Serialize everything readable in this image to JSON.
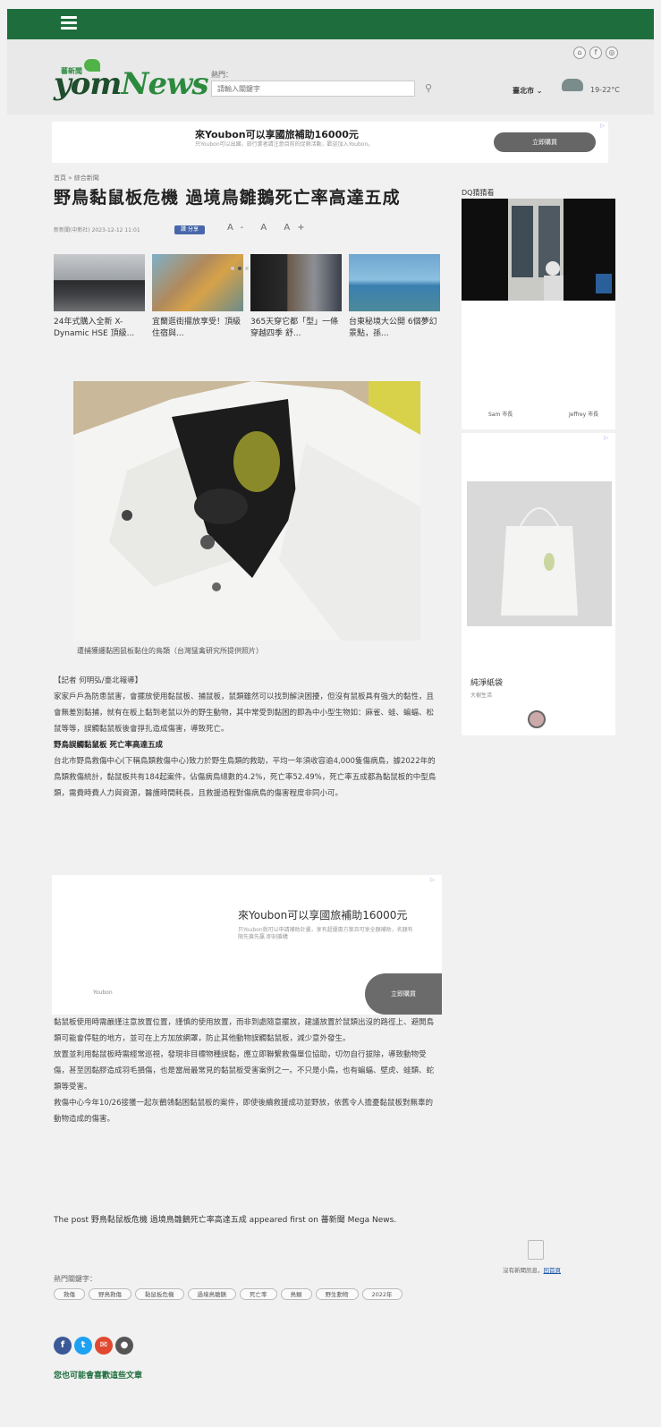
{
  "header": {
    "logo_prefix": "yom",
    "logo_suffix": "News",
    "logo_tag": "蕃新聞",
    "search_label": "熱門：",
    "search_placeholder": "請輸入關鍵字",
    "city": "臺北市",
    "temperature": "19-22°C"
  },
  "top_ad": {
    "title": "來Youbon可以享國旅補助16000元",
    "desc": "只Youbon可以出國，旅行業者請注意目前的促銷活動，歡迎加入Youbon。",
    "button": "立即購買"
  },
  "article": {
    "breadcrumb": "首頁 » 綜合新聞",
    "title": "野鳥黏鼠板危機 過境鳥雛鵝死亡率高達五成",
    "meta": "新新聞(中新社) 2023-12-12 11:01",
    "like": "讚 分享",
    "font_sizes": "A- A A+",
    "carousel": [
      {
        "caption": "24年式購入全新 X-Dynamic HSE 頂級..."
      },
      {
        "caption": "宜蘭逛街擺放享受！頂級住宿與..."
      },
      {
        "caption": "365天穿它都「型」一條穿越四季 舒..."
      },
      {
        "caption": "台東秘境大公開 6個夢幻景點，孫..."
      }
    ],
    "photo_caption": "遭捕獲纏黏困鼠板黏住的鳥類（台灣猛禽研究所提供照片）",
    "paragraphs": [
      "【記者 何明弘/臺北報導】",
      "家家戶戶為防患鼠害，會擺放使用黏鼠板、捕鼠板，鼠類雖然可以找到解決困擾，但沒有鼠板具有強大的黏性，且會無差別黏捕，就有在板上黏到老鼠以外的野生動物，其中常受到黏困的即為中小型生物如：麻雀、蛙、蝙蝠、松鼠等等，誤觸黏鼠板後會掙扎造成傷害，導致死亡。"
    ],
    "subheading": "野鳥誤觸黏鼠板 死亡率高達五成",
    "paragraph_after_sub": "台北市野鳥救傷中心(下稱鳥類救傷中心)致力於野生鳥類的救助，平均一年須收容逾4,000隻傷病鳥，據2022年的鳥類救傷統計，黏鼠板共有184起案件，佔傷病鳥總數的4.2%，死亡率52.49%，死亡率五成都為黏鼠板的中型鳥類，需費時費人力與資源，醫護時間耗長，且救援過程對傷病鳥的傷害程度非同小可。",
    "mid_ad": {
      "title": "來Youbon可以享國旅補助16000元",
      "desc": "只Youbon就可以申請補助計畫，享有超優惠方案且可享全額補助，名額有限先搶先贏 即刻搶購",
      "brand": "Youbon",
      "button": "立即購買"
    },
    "paragraphs_after_ad": [
      "黏鼠板使用時需嚴謹注意放置位置，謹慎的使用放置，而非到處隨意擺放，建議放置於鼠類出沒的路徑上、避開鳥類可能會停駐的地方，並可在上方加放網罩，防止其他動物誤觸黏鼠板，減少意外發生。",
      "放置並利用黏鼠板時需經常巡視，發現非目標物種誤黏，應立即聯繫救傷單位協助，切勿自行拔除，導致動物受傷，甚至因黏膠造成羽毛損傷，也是當局最常見的黏鼠板受害案例之一。不只是小鳥，也有蝙蝠、壁虎、蛙類、蛇類等受害。",
      "救傷中心今年10/26接獲一起灰鶺鴒黏困黏鼠板的案件，即使後續救援成功並野放，依舊令人擔憂黏鼠板對無辜的動物造成的傷害。"
    ],
    "post_line": "The post 野鳥黏鼠板危機 過境鳥雛鵝死亡率高達五成 appeared first on 蕃新聞 Mega News.",
    "keywords_label": "熱門關鍵字：",
    "keywords": [
      "救傷",
      "野鳥救傷",
      "黏鼠板危機",
      "過境鳥雛鵝",
      "死亡率",
      "鳥類",
      "野生動物",
      "2022年"
    ],
    "related_title": "您也可能會喜歡這些文章"
  },
  "sidebar": {
    "label": "DQ猜猜看",
    "video_text_a": "Sam 市長",
    "video_text_b": "Jeffrey 市長",
    "ad_name": "純淨紙袋",
    "ad_sub": "大樹生活",
    "empty_text": "沒有新聞訊息",
    "empty_link": "回首頁"
  },
  "colors": {
    "brand_green": "#1e6e3d",
    "link_blue": "#1a55aa"
  }
}
